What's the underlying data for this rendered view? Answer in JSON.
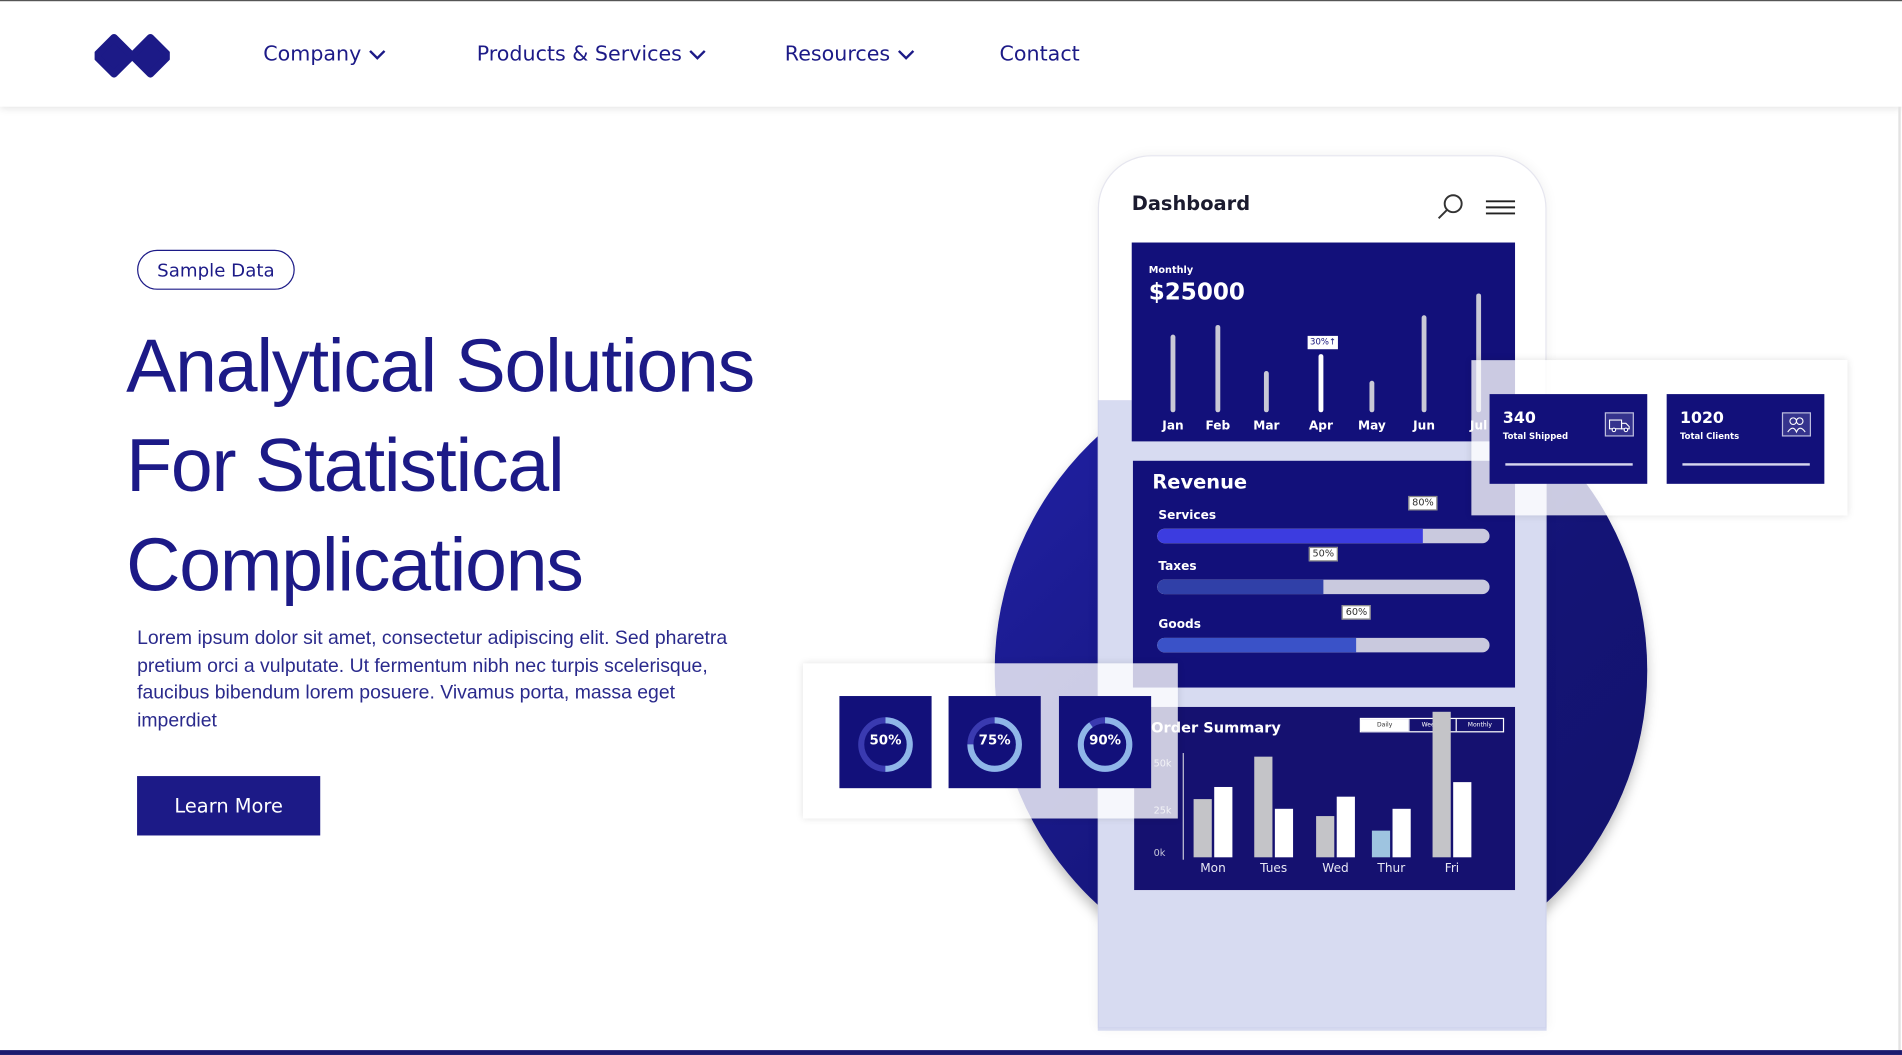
{
  "brand": {
    "logo_icon": "double-diamond-logo",
    "accent": "#1c1a87"
  },
  "nav": {
    "company": "Company",
    "products": "Products & Services",
    "resources": "Resources",
    "contact": "Contact"
  },
  "hero": {
    "badge": "Sample Data",
    "headline": [
      "Analytical Solutions",
      "For Statistical",
      "Complications"
    ],
    "body": "Lorem ipsum dolor sit amet, consectetur adipiscing elit. Sed pharetra pretium orci a vulputate. Ut fermentum nibh nec turpis scelerisque, faucibus bibendum lorem posuere. Vivamus porta, massa eget imperdiet",
    "cta": "Learn More"
  },
  "dashboard": {
    "title": "Dashboard",
    "monthly": {
      "label": "Monthly",
      "value": "$25000",
      "tag": "30%↑",
      "months": [
        "Jan",
        "Feb",
        "Mar",
        "Apr",
        "May",
        "Jun",
        "Jul"
      ],
      "levels": [
        0.53,
        0.6,
        0.28,
        0.4,
        0.22,
        0.67,
        0.82
      ]
    },
    "revenue": {
      "title": "Revenue",
      "items": [
        {
          "label": "Services",
          "percent": 80,
          "tag": "80%",
          "color": "#3c3ce0"
        },
        {
          "label": "Taxes",
          "percent": 50,
          "tag": "50%",
          "color": "#3040a8"
        },
        {
          "label": "Goods",
          "percent": 60,
          "tag": "60%",
          "color": "#3a52c8"
        }
      ]
    },
    "orders": {
      "title": "Order Summary",
      "tabs": [
        "Daily",
        "Weekly",
        "Monthly"
      ],
      "yticks": [
        "50k",
        "25k",
        "0k"
      ],
      "days": [
        "Mon",
        "Tues",
        "Wed",
        "Thur",
        "Fri"
      ],
      "grey": [
        30,
        52,
        21,
        14,
        75
      ],
      "white": [
        36,
        25,
        31,
        25,
        39
      ]
    }
  },
  "stats": [
    {
      "value": "340",
      "label": "Total Shipped",
      "icon": "truck-icon"
    },
    {
      "value": "1020",
      "label": "Total Clients",
      "icon": "users-icon"
    }
  ],
  "rings": [
    {
      "label": "50%",
      "percent": 50
    },
    {
      "label": "75%",
      "percent": 75
    },
    {
      "label": "90%",
      "percent": 90
    }
  ]
}
